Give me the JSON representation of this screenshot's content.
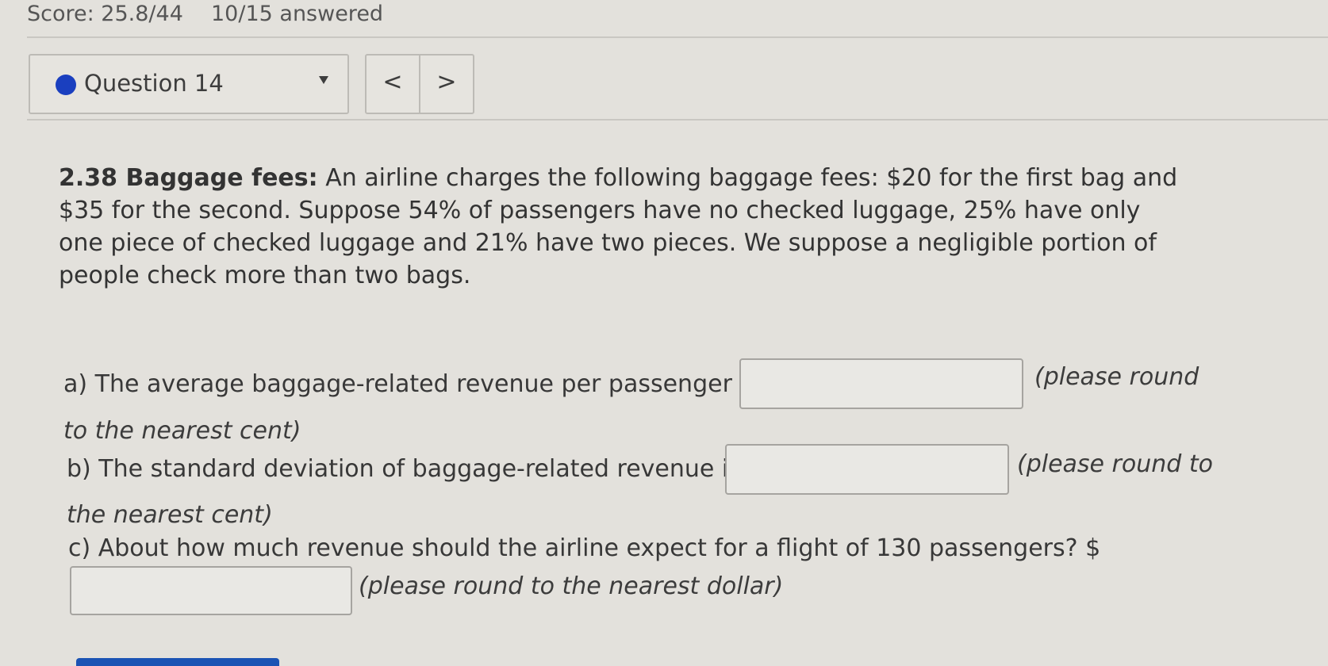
{
  "header": {
    "score": "Score: 25.8/44",
    "answered": "10/15 answered"
  },
  "question_nav": {
    "current": "Question 14",
    "status_color": "#1a3fbf",
    "prev_label": "<",
    "next_label": ">"
  },
  "problem": {
    "number_title": "2.38 Baggage fees:",
    "body": "An airline charges the following baggage fees: $20 for the first bag and $35 for the second. Suppose 54% of passengers have no checked luggage, 25% have only one piece of checked luggage and 21% have two pieces. We suppose a negligible portion of people check more than two bags."
  },
  "parts": {
    "a": {
      "prompt": "a) The average baggage-related revenue per passenger is: $",
      "hint_line1": "(please round",
      "hint_line2": "to the nearest cent)",
      "value": ""
    },
    "b": {
      "prompt": "b) The standard deviation of baggage-related revenue is: $",
      "hint_line1": "(please round to",
      "hint_line2": "the nearest cent)",
      "value": ""
    },
    "c": {
      "prompt": "c) About how much revenue should the airline expect for a flight of 130 passengers? $",
      "hint": "(please round to the nearest dollar)",
      "value": ""
    }
  }
}
